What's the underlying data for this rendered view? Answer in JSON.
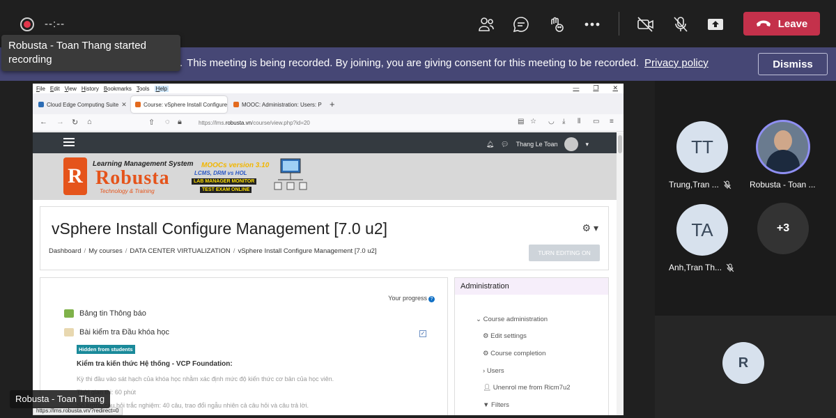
{
  "meeting": {
    "timer": "--:--",
    "leave_label": "Leave",
    "toast_text": "Robusta - Toan Thang started recording",
    "banner_text": "This meeting is being recorded. By joining, you are giving consent for this meeting to be recorded.",
    "privacy_link": "Privacy policy",
    "dismiss_label": "Dismiss",
    "presenter_name": "Robusta - Toan Thang",
    "colors": {
      "leave": "#c4314b",
      "banner": "#464775",
      "record": "#e2364c"
    }
  },
  "toolbar_icons": [
    "people-icon",
    "chat-icon",
    "raise-hand-icon",
    "more-icon",
    "camera-off-icon",
    "mic-off-icon",
    "share-screen-icon",
    "phone-icon"
  ],
  "participants": {
    "tiles": [
      {
        "initials": "TT",
        "name": "Trung,Tran ...",
        "muted": true
      },
      {
        "initials": "",
        "name": "Robusta - Toan ...",
        "muted": false
      },
      {
        "initials": "TA",
        "name": "Anh,Tran Th...",
        "muted": true
      }
    ],
    "overflow": "+3",
    "bottom_initial": "R"
  },
  "browser": {
    "menu": [
      "File",
      "Edit",
      "View",
      "History",
      "Bookmarks",
      "Tools",
      "Help"
    ],
    "tabs": [
      {
        "label": "Cloud Edge Computing Suite"
      },
      {
        "label": "Course: vSphere Install Configure"
      },
      {
        "label": "MOOC: Administration: Users: P"
      }
    ],
    "url_prefix": "https://lms.",
    "url_domain": "robusta.vn",
    "url_path": "/course/view.php?id=20",
    "status_url": "https://lms.robusta.vn/?redirect=0"
  },
  "moodle": {
    "user_name": "Thang Le Toan",
    "logo": {
      "tagline": "Learning Management System",
      "name": "Robusta",
      "sub": "Technology & Training",
      "moocs": "MOOCs version 3.10",
      "lcms": "LCMS, DRM vs HOL",
      "lab": "LAB MANAGER MONITOR",
      "exam": "TEST EXAM ONLINE"
    },
    "course_title": "vSphere Install Configure Management [7.0 u2]",
    "breadcrumb": [
      "Dashboard",
      "My courses",
      "DATA CENTER VIRTUALIZATION",
      "vSphere Install Configure Management [7.0 u2]"
    ],
    "edit_button": "TURN EDITING ON",
    "progress_label": "Your progress",
    "activities": [
      "Bảng tin Thông báo",
      "Bài kiểm tra Đầu khóa học"
    ],
    "hidden_badge": "Hidden from students",
    "description_title": "Kiểm tra kiến thức Hệ thống - VCP Foundation:",
    "description_lines": [
      "Kỳ thi đầu vào sát hạch của khóa học nhằm xác định mức độ kiến thức cơ bản của học viên.",
      "Thời gian thi: 60 phút",
      "Số lượng câu hỏi trắc nghiệm: 40 câu, trao đổi ngẫu nhiên cả câu hỏi và câu trả lời."
    ],
    "admin": {
      "title": "Administration",
      "items": [
        "Course administration",
        "Edit settings",
        "Course completion",
        "Users",
        "Unenrol me from Ricm7u2",
        "Filters"
      ]
    }
  }
}
